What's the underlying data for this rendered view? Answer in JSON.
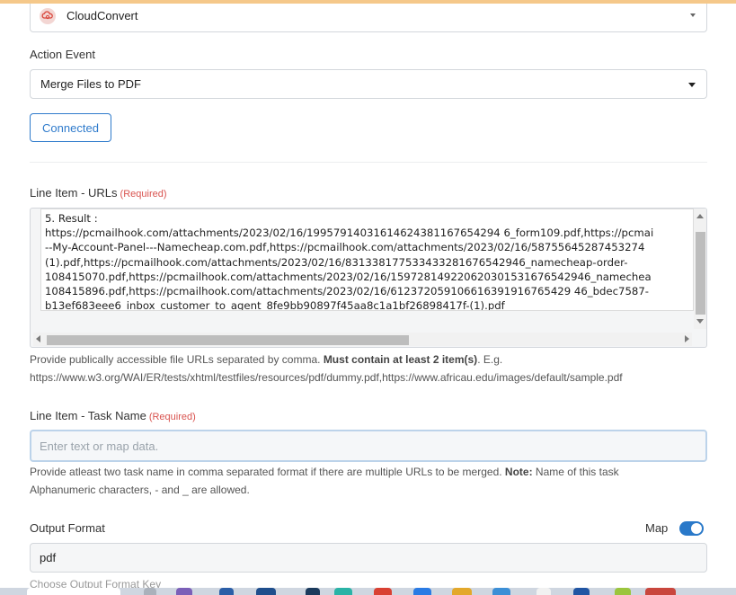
{
  "app_select": {
    "icon": "cloudconvert-icon",
    "label": "CloudConvert"
  },
  "action_event": {
    "label": "Action Event",
    "value": "Merge Files to PDF"
  },
  "connected_button": {
    "label": "Connected"
  },
  "urls_field": {
    "label": "Line Item - URLs",
    "required": "(Required)",
    "value": "5. Result :\nhttps://pcmailhook.com/attachments/2023/02/16/19957914031614624381167654294 6_form109.pdf,https://pcmai\n--My-Account-Panel---Namecheap.com.pdf,https://pcmailhook.com/attachments/2023/02/16/58755645287453274\n(1).pdf,https://pcmailhook.com/attachments/2023/02/16/831338177533433281676542946_namecheap-order-\n108415070.pdf,https://pcmailhook.com/attachments/2023/02/16/159728149220620301531676542946_namechea\n108415896.pdf,https://pcmailhook.com/attachments/2023/02/16/612372059106616391916765429 46_bdec7587-\nb13ef683eee6_inbox_customer_to_agent_8fe9bb90897f45aa8c1a1bf26898417f-(1).pdf",
    "help_prefix": "Provide publically accessible file URLs separated by comma. ",
    "help_bold": "Must contain at least 2 item(s)",
    "help_suffix": ". E.g.",
    "help_example": "https://www.w3.org/WAI/ER/tests/xhtml/testfiles/resources/pdf/dummy.pdf,https://www.africau.edu/images/default/sample.pdf"
  },
  "task_name_field": {
    "label": "Line Item - Task Name",
    "required": "(Required)",
    "placeholder": "Enter text or map data.",
    "help_prefix": "Provide atleast two task name in comma separated format if there are multiple URLs to be merged. ",
    "help_bold": "Note:",
    "help_suffix": " Name of this task",
    "help_line2": "Alphanumeric characters, - and _ are allowed."
  },
  "output_format": {
    "label": "Output Format",
    "map_label": "Map",
    "map_enabled": true,
    "value": "pdf"
  },
  "next_field_partial": "Choose Output Format Key",
  "colors": {
    "accent": "#2a79c9",
    "required": "#d9534f",
    "top_strip": "#f5c88a"
  }
}
